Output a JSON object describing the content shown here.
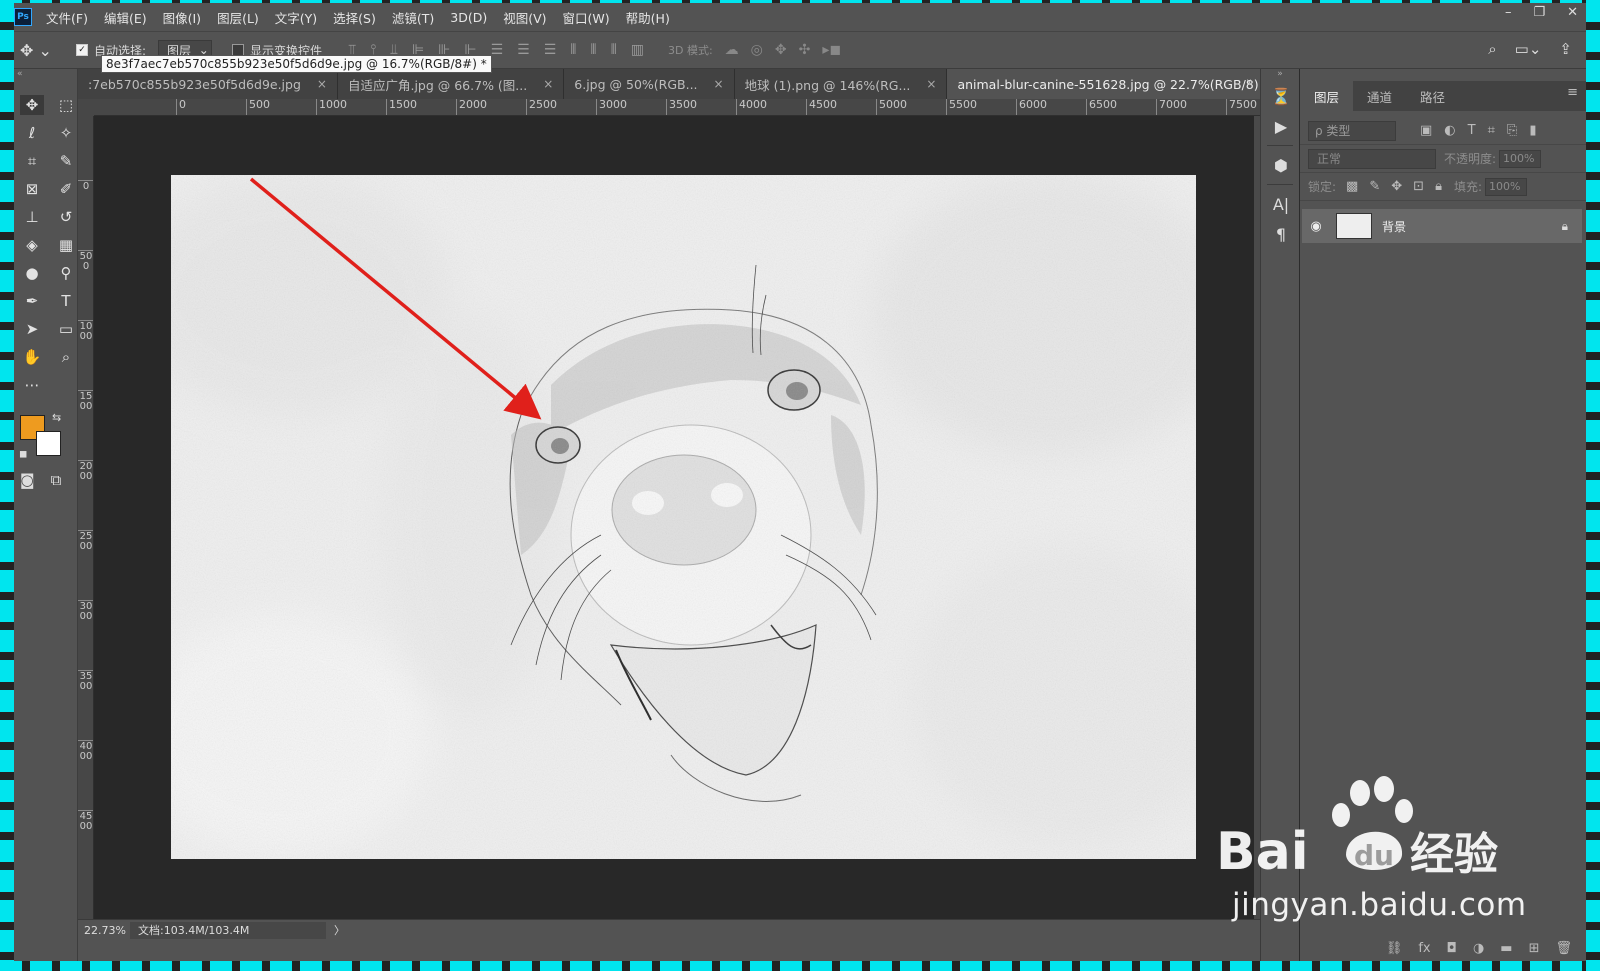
{
  "app": {
    "logo": "Ps",
    "menu": [
      "文件(F)",
      "编辑(E)",
      "图像(I)",
      "图层(L)",
      "文字(Y)",
      "选择(S)",
      "滤镜(T)",
      "3D(D)",
      "视图(V)",
      "窗口(W)",
      "帮助(H)"
    ]
  },
  "options": {
    "auto_select_label": "自动选择:",
    "auto_select_value": "图层",
    "show_transform_label": "显示变换控件",
    "mode_3d_label": "3D 模式:"
  },
  "tabs": [
    {
      "label": ":7eb570c855b923e50f5d6d9e.jpg",
      "active": false
    },
    {
      "label": "自适应广角.jpg @ 66.7% (图...",
      "active": false
    },
    {
      "label": "6.jpg @ 50%(RGB...",
      "active": false
    },
    {
      "label": "地球 (1).png @ 146%(RG...",
      "active": false
    },
    {
      "label": "animal-blur-canine-551628.jpg @ 22.7%(RGB/8) *",
      "active": true
    }
  ],
  "tooltip": "8e3f7aec7eb570c855b923e50f5d6d9e.jpg @ 16.7%(RGB/8#) *",
  "ruler_h": [
    "0",
    "500",
    "1000",
    "1500",
    "2000",
    "2500",
    "3000",
    "3500",
    "4000",
    "4500",
    "5000",
    "5500",
    "6000",
    "6500",
    "7000",
    "7500"
  ],
  "ruler_v": [
    "0",
    "500",
    "1000",
    "1500",
    "2000",
    "2500",
    "3000",
    "3500",
    "4000",
    "4500"
  ],
  "status": {
    "zoom": "22.73%",
    "doc_info": "文档:103.4M/103.4M",
    "arrow": "〉"
  },
  "layers_panel": {
    "tabs": [
      "图层",
      "通道",
      "路径"
    ],
    "filter_placeholder": "ρ 类型",
    "blend_mode": "正常",
    "opacity_label": "不透明度:",
    "opacity_value": "100%",
    "lock_label": "锁定:",
    "fill_label": "填充:",
    "fill_value": "100%",
    "layer_name": "背景"
  },
  "watermark": {
    "text": "jingyan.baidu.com"
  },
  "colors": {
    "foreground": "#ee9b1f",
    "background": "#ffffff",
    "arrow": "#e0201b"
  }
}
